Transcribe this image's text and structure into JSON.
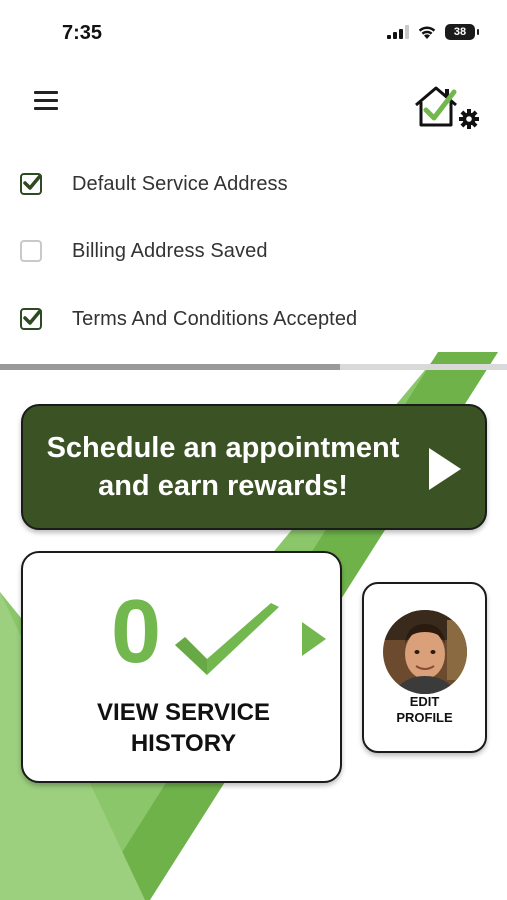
{
  "status_bar": {
    "time": "7:35",
    "battery": "38"
  },
  "header": {
    "menu_icon": "hamburger-menu-icon",
    "settings_icon": "home-check-settings-icon"
  },
  "checklist": [
    {
      "label": "Default Service Address",
      "checked": true
    },
    {
      "label": "Billing Address Saved",
      "checked": false
    },
    {
      "label": "Terms And Conditions Accepted",
      "checked": true
    }
  ],
  "progress": {
    "fraction": 0.67
  },
  "schedule": {
    "line1": "Schedule an appointment",
    "line2": "and earn rewards!"
  },
  "service": {
    "count": "0",
    "label": "VIEW SERVICE\nHISTORY"
  },
  "profile": {
    "label": "EDIT\nPROFILE"
  },
  "colors": {
    "brand_dark_green": "#3b5324",
    "brand_light_green": "#72b84e",
    "accent_green": "#8cc66b"
  }
}
